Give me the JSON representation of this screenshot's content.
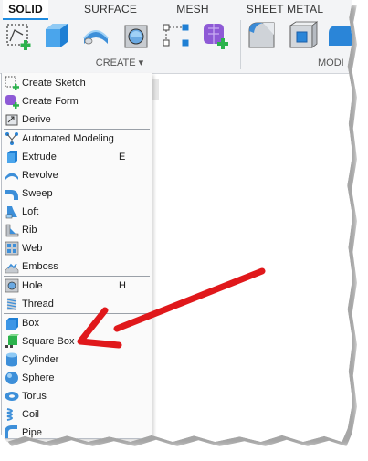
{
  "toolbar": {
    "tabs": {
      "solid": "SOLID",
      "surface": "SURFACE",
      "mesh": "MESH",
      "sheet_metal": "SHEET METAL"
    },
    "groups": {
      "create": "CREATE ▾",
      "modify": "MODI"
    }
  },
  "menu": {
    "items": [
      {
        "label": "Create Sketch",
        "icon": "sketch-icon"
      },
      {
        "label": "Create Form",
        "icon": "form-icon"
      },
      {
        "label": "Derive",
        "icon": "derive-icon"
      },
      {
        "label": "Automated Modeling",
        "icon": "automated-modeling-icon"
      },
      {
        "label": "Extrude",
        "icon": "extrude-icon",
        "shortcut": "E"
      },
      {
        "label": "Revolve",
        "icon": "revolve-icon"
      },
      {
        "label": "Sweep",
        "icon": "sweep-icon"
      },
      {
        "label": "Loft",
        "icon": "loft-icon"
      },
      {
        "label": "Rib",
        "icon": "rib-icon"
      },
      {
        "label": "Web",
        "icon": "web-icon"
      },
      {
        "label": "Emboss",
        "icon": "emboss-icon"
      },
      {
        "label": "Hole",
        "icon": "hole-icon",
        "shortcut": "H"
      },
      {
        "label": "Thread",
        "icon": "thread-icon"
      },
      {
        "label": "Box",
        "icon": "box-icon"
      },
      {
        "label": "Square Box",
        "icon": "square-box-icon"
      },
      {
        "label": "Cylinder",
        "icon": "cylinder-icon"
      },
      {
        "label": "Sphere",
        "icon": "sphere-icon"
      },
      {
        "label": "Torus",
        "icon": "torus-icon"
      },
      {
        "label": "Coil",
        "icon": "coil-icon"
      },
      {
        "label": "Pipe",
        "icon": "pipe-icon"
      }
    ]
  },
  "colors": {
    "accent_blue": "#1e8be0",
    "arrow_red": "#e0181b",
    "green_plus": "#2bb24c",
    "purple": "#8e5ad6"
  }
}
